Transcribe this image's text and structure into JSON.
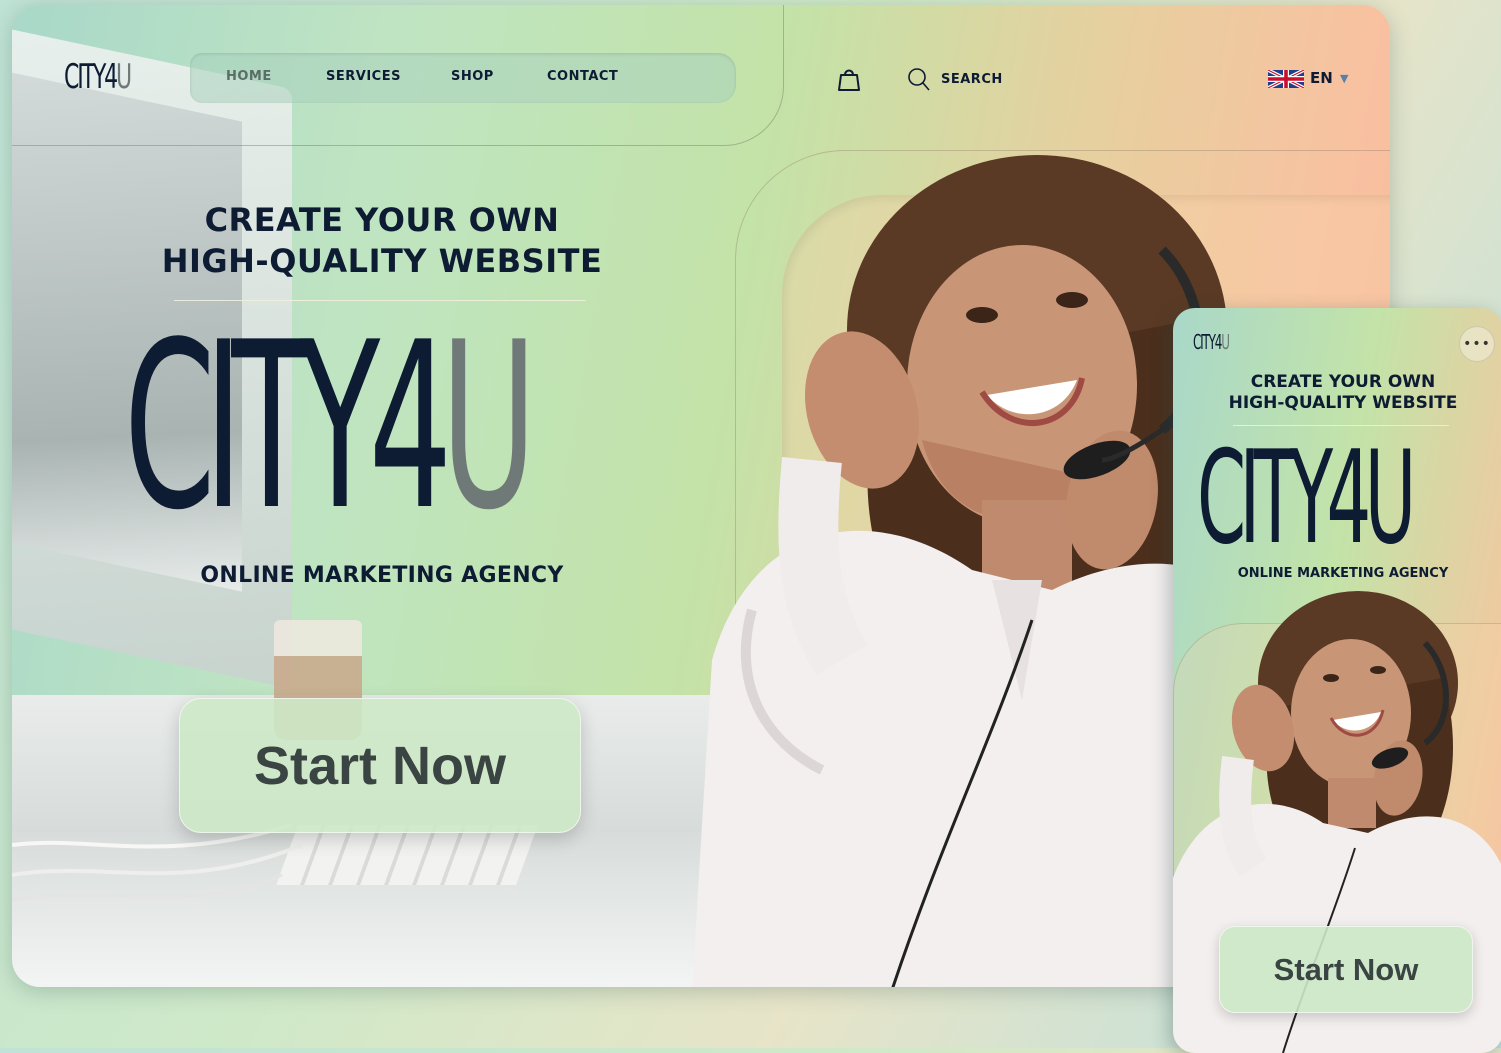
{
  "brand": {
    "logo_dark": "CITY4",
    "logo_grey": "U"
  },
  "nav": {
    "items": [
      {
        "label": "HOME",
        "active": true
      },
      {
        "label": "SERVICES"
      },
      {
        "label": "SHOP"
      },
      {
        "label": "CONTACT"
      }
    ]
  },
  "header": {
    "search_label": "SEARCH",
    "language": "EN",
    "cart_icon": "shopping-bag-icon",
    "search_icon": "search-icon",
    "flag_icon": "uk-flag-icon"
  },
  "hero": {
    "title_line1": "CREATE YOUR OWN",
    "title_line2": "HIGH-QUALITY WEBSITE",
    "logo_dark": "CITY4",
    "logo_grey": "U",
    "subtitle": "ONLINE MARKETING AGENCY",
    "cta": "Start Now"
  },
  "mobile": {
    "logo_dark": "CITY4",
    "logo_grey": "U",
    "more_icon": "more-horizontal-icon",
    "title_line1": "CREATE YOUR OWN",
    "title_line2": "HIGH-QUALITY WEBSITE",
    "big_logo_dark": "CITY4",
    "big_logo_grey": "U",
    "subtitle": "ONLINE MARKETING AGENCY",
    "cta": "Start Now"
  },
  "colors": {
    "text_dark": "#0d1b33",
    "logo_grey": "#6f7a78",
    "button_bg": "#cde8c6",
    "gradient_green": "#c3e3a8",
    "gradient_peach": "#f5b99b"
  }
}
